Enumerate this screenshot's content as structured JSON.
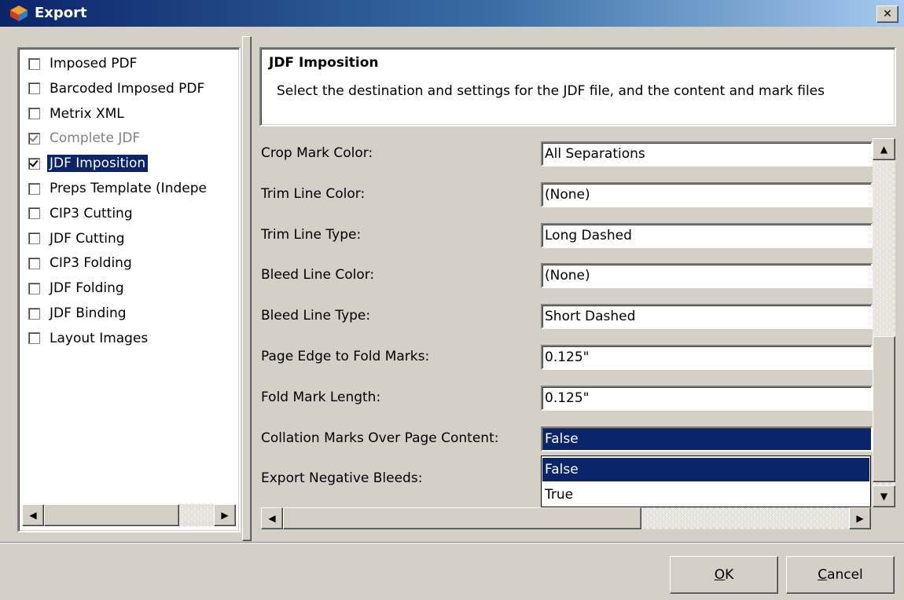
{
  "window": {
    "title": "Export",
    "close_label": "✕",
    "accent_color": "#0a246a"
  },
  "export_list": {
    "items": [
      {
        "label": "Imposed PDF",
        "checked": false,
        "disabled": false,
        "selected": false
      },
      {
        "label": "Barcoded Imposed PDF",
        "checked": false,
        "disabled": false,
        "selected": false
      },
      {
        "label": "Metrix XML",
        "checked": false,
        "disabled": false,
        "selected": false
      },
      {
        "label": "Complete JDF",
        "checked": true,
        "disabled": true,
        "selected": false
      },
      {
        "label": "JDF Imposition",
        "checked": true,
        "disabled": false,
        "selected": true
      },
      {
        "label": "Preps Template (Indepe",
        "checked": false,
        "disabled": false,
        "selected": false
      },
      {
        "label": "CIP3 Cutting",
        "checked": false,
        "disabled": false,
        "selected": false
      },
      {
        "label": "JDF Cutting",
        "checked": false,
        "disabled": false,
        "selected": false
      },
      {
        "label": "CIP3 Folding",
        "checked": false,
        "disabled": false,
        "selected": false
      },
      {
        "label": "JDF Folding",
        "checked": false,
        "disabled": false,
        "selected": false
      },
      {
        "label": "JDF Binding",
        "checked": false,
        "disabled": false,
        "selected": false
      },
      {
        "label": "Layout Images",
        "checked": false,
        "disabled": false,
        "selected": false
      }
    ]
  },
  "header": {
    "title": "JDF Imposition",
    "description": "Select the destination and settings for the JDF file, and the content and mark files"
  },
  "properties": [
    {
      "label": "Crop Mark Color:",
      "value": "All Separations"
    },
    {
      "label": "Trim Line Color:",
      "value": "(None)"
    },
    {
      "label": "Trim Line Type:",
      "value": "Long Dashed"
    },
    {
      "label": "Bleed Line Color:",
      "value": "(None)"
    },
    {
      "label": "Bleed Line Type:",
      "value": "Short Dashed"
    },
    {
      "label": "Page Edge to Fold Marks:",
      "value": "0.125\""
    },
    {
      "label": "Fold Mark Length:",
      "value": "0.125\""
    },
    {
      "label": "Collation Marks Over Page Content:",
      "value": "False"
    },
    {
      "label": "Export Negative Bleeds:",
      "value": ""
    }
  ],
  "dropdown": {
    "options": [
      "False",
      "True"
    ],
    "selected": "False"
  },
  "scroll_icons": {
    "up": "▲",
    "down": "▼",
    "left": "◀",
    "right": "▶"
  },
  "buttons": {
    "ok_mnemonic": "O",
    "ok_rest": "K",
    "cancel_mnemonic": "C",
    "cancel_rest": "ancel"
  }
}
